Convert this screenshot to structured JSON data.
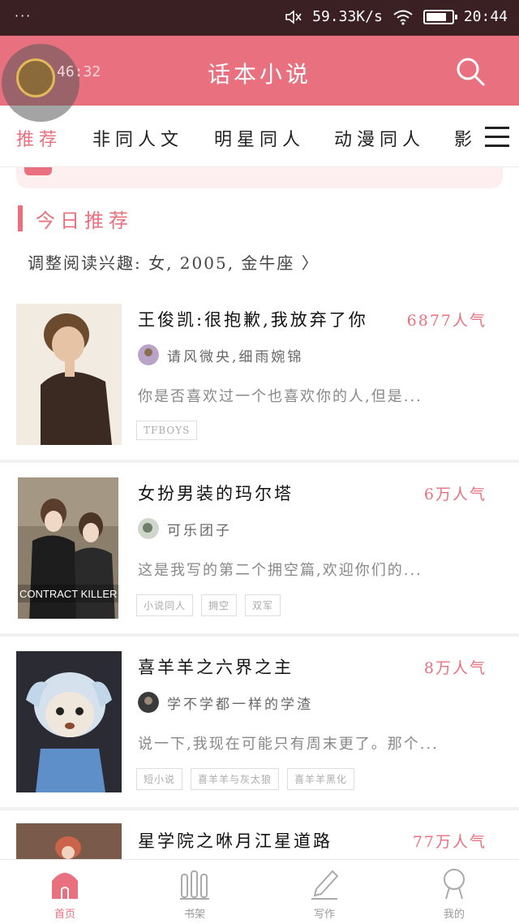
{
  "status_bar": {
    "dots": "···",
    "speed": "59.33K/s",
    "time": "20:44",
    "battery_level": 0.8
  },
  "header": {
    "title": "话本小说",
    "timer": "46:32"
  },
  "tabs": [
    {
      "label": "推荐",
      "active": true
    },
    {
      "label": "非同人文",
      "active": false
    },
    {
      "label": "明星同人",
      "active": false
    },
    {
      "label": "动漫同人",
      "active": false
    },
    {
      "label": "影",
      "active": false
    }
  ],
  "section": {
    "title": "今日推荐"
  },
  "reading_prefs": "调整阅读兴趣: 女, 2005, 金牛座 〉",
  "books": [
    {
      "title": "王俊凯:很抱歉,我放弃了你",
      "popularity": "6877人气",
      "author": "请风微央,细雨婉锦",
      "description": "你是否喜欢过一个也喜欢你的人,但是...",
      "tags": [
        "TFBOYS"
      ]
    },
    {
      "title": "女扮男装的玛尔塔",
      "popularity": "6万人气",
      "author": "可乐团子",
      "description": "这是我写的第二个拥空篇,欢迎你们的...",
      "tags": [
        "小说同人",
        "拥空",
        "双军"
      ],
      "cover_text": "CONTRACT KILLER"
    },
    {
      "title": "喜羊羊之六界之主",
      "popularity": "8万人气",
      "author": "学不学都一样的学渣",
      "description": "说一下,我现在可能只有周末更了。那个...",
      "tags": [
        "短小说",
        "喜羊羊与灰太狼",
        "喜羊羊黑化"
      ]
    },
    {
      "title": "星学院之咻月江星道路",
      "popularity": "77万人气"
    }
  ],
  "bottom_nav": [
    {
      "label": "首页",
      "icon": "home-icon",
      "active": true
    },
    {
      "label": "书架",
      "icon": "bookshelf-icon",
      "active": false
    },
    {
      "label": "写作",
      "icon": "pencil-icon",
      "active": false
    },
    {
      "label": "我的",
      "icon": "user-icon",
      "active": false
    }
  ],
  "colors": {
    "accent": "#e9707f",
    "statusbar": "#3a1f23"
  }
}
